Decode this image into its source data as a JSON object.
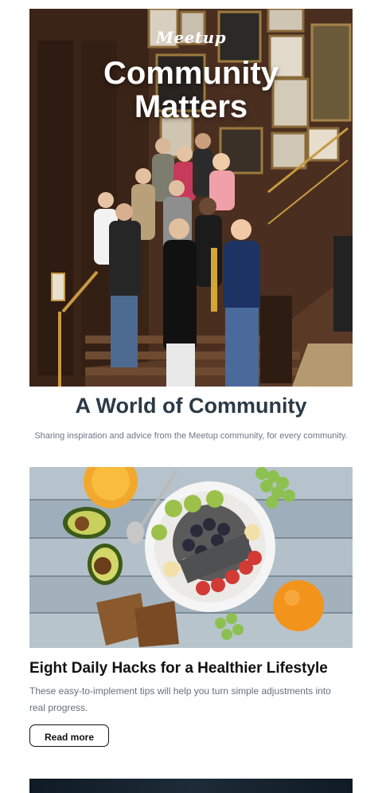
{
  "hero": {
    "brand": "Meetup",
    "title_line1": "Community",
    "title_line2": "Matters"
  },
  "section": {
    "title": "A World of Community",
    "subtitle": "Sharing inspiration and advice from the Meetup community, for every community."
  },
  "article": {
    "title": "Eight Daily Hacks for a Healthier Lifestyle",
    "description": "These easy-to-implement tips will help you turn simple adjustments into real progress.",
    "button_label": "Read more"
  },
  "colors": {
    "heading": "#2b3a47",
    "muted_text": "#6b7785",
    "button_border": "#111111"
  }
}
